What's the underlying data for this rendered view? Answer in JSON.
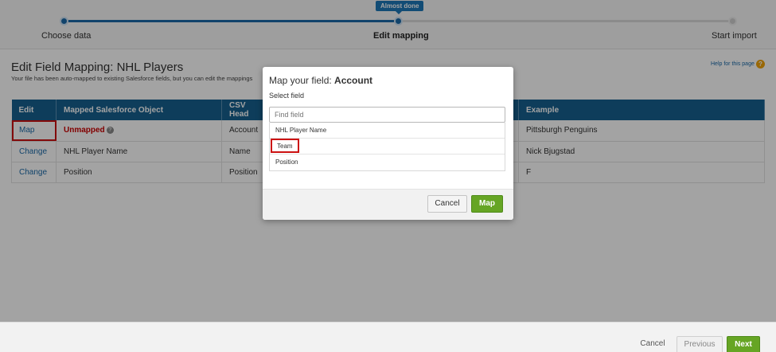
{
  "progress": {
    "badge": "Almost done",
    "steps": [
      {
        "label": "Choose data",
        "state": "done"
      },
      {
        "label": "Edit mapping",
        "state": "active"
      },
      {
        "label": "Start import",
        "state": "todo"
      }
    ]
  },
  "page": {
    "title": "Edit Field Mapping: NHL Players",
    "subtitle": "Your file has been auto-mapped to existing Salesforce fields, but you can edit the mappings",
    "help_link": "Help for this page",
    "help_icon": "help-icon"
  },
  "table": {
    "headers": [
      "Edit",
      "Mapped Salesforce Object",
      "CSV Head",
      "",
      "Example"
    ],
    "rows": [
      {
        "edit": "Map",
        "mapped": "Unmapped",
        "csv": "Account",
        "example": "Pittsburgh Penguins"
      },
      {
        "edit": "Change",
        "mapped": "NHL Player Name",
        "csv": "Name",
        "example": "Nick Bjugstad"
      },
      {
        "edit": "Change",
        "mapped": "Position",
        "csv": "Position",
        "example": "F"
      }
    ]
  },
  "modal": {
    "title_prefix": "Map your field:",
    "title_field": "Account",
    "subtitle": "Select field",
    "search_placeholder": "Find field",
    "options": [
      "NHL Player Name",
      "Team",
      "Position"
    ],
    "cancel_label": "Cancel",
    "map_label": "Map"
  },
  "footer": {
    "cancel_label": "Cancel",
    "previous_label": "Previous",
    "next_label": "Next"
  },
  "colors": {
    "primary": "#1b6aa8",
    "header": "#16608f",
    "accent_green": "#66a524",
    "error_red": "#cc1111"
  }
}
